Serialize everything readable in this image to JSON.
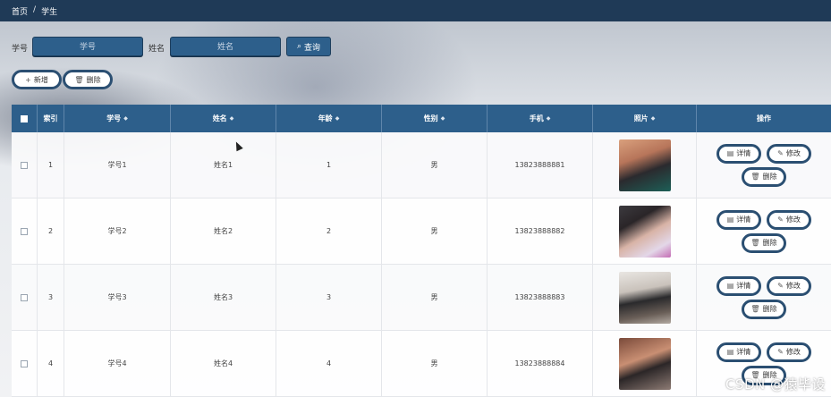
{
  "breadcrumb": {
    "home": "首页",
    "separator": "/",
    "current": "学生"
  },
  "search": {
    "student_no_label": "学号",
    "student_no_placeholder": "学号",
    "name_label": "姓名",
    "name_placeholder": "姓名",
    "query_label": "查询"
  },
  "actions": {
    "add_label": "新增",
    "delete_label": "删除"
  },
  "table": {
    "columns": [
      "索引",
      "学号",
      "姓名",
      "年龄",
      "性别",
      "手机",
      "照片",
      "操作"
    ],
    "rows": [
      {
        "index": "1",
        "student_no": "学号1",
        "name": "姓名1",
        "age": "1",
        "gender": "男",
        "phone": "13823888881"
      },
      {
        "index": "2",
        "student_no": "学号2",
        "name": "姓名2",
        "age": "2",
        "gender": "男",
        "phone": "13823888882"
      },
      {
        "index": "3",
        "student_no": "学号3",
        "name": "姓名3",
        "age": "3",
        "gender": "男",
        "phone": "13823888883"
      },
      {
        "index": "4",
        "student_no": "学号4",
        "name": "姓名4",
        "age": "4",
        "gender": "男",
        "phone": "13823888884"
      }
    ],
    "row_actions": {
      "detail": "详情",
      "edit": "修改",
      "delete": "删除"
    }
  },
  "icons": {
    "search": "search-icon",
    "add": "plus-icon",
    "delete": "trash-icon",
    "detail": "document-icon",
    "edit": "pencil-icon",
    "sort": "sort-icon"
  },
  "colors": {
    "topbar": "#1f3a57",
    "header": "#2d5f8b",
    "button_border": "#2b4f72"
  },
  "watermark": "CSDN @猿毕设"
}
